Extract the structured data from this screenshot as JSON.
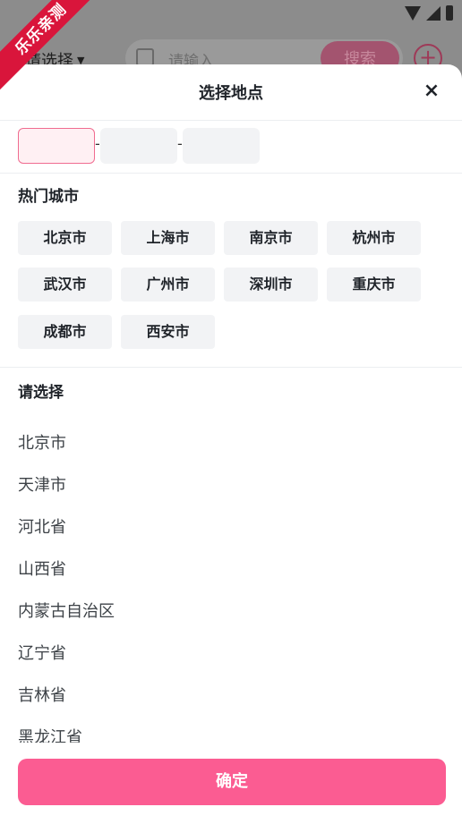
{
  "watermark": "乐乐亲测",
  "background_app": {
    "location_label": "请选择",
    "search_placeholder": "请输入",
    "search_button": "搜索"
  },
  "sheet": {
    "title": "选择地点",
    "close_label": "×",
    "hot_cities_title": "热门城市",
    "hot_cities": [
      "北京市",
      "上海市",
      "南京市",
      "杭州市",
      "武汉市",
      "广州市",
      "深圳市",
      "重庆市",
      "成都市",
      "西安市"
    ],
    "pick_title": "请选择",
    "provinces": [
      "北京市",
      "天津市",
      "河北省",
      "山西省",
      "内蒙古自治区",
      "辽宁省",
      "吉林省",
      "黑龙江省"
    ],
    "confirm_label": "确定"
  },
  "colors": {
    "accent": "#fb5c92",
    "chip_bg": "#f2f3f5",
    "ribbon": "#d9153b"
  }
}
